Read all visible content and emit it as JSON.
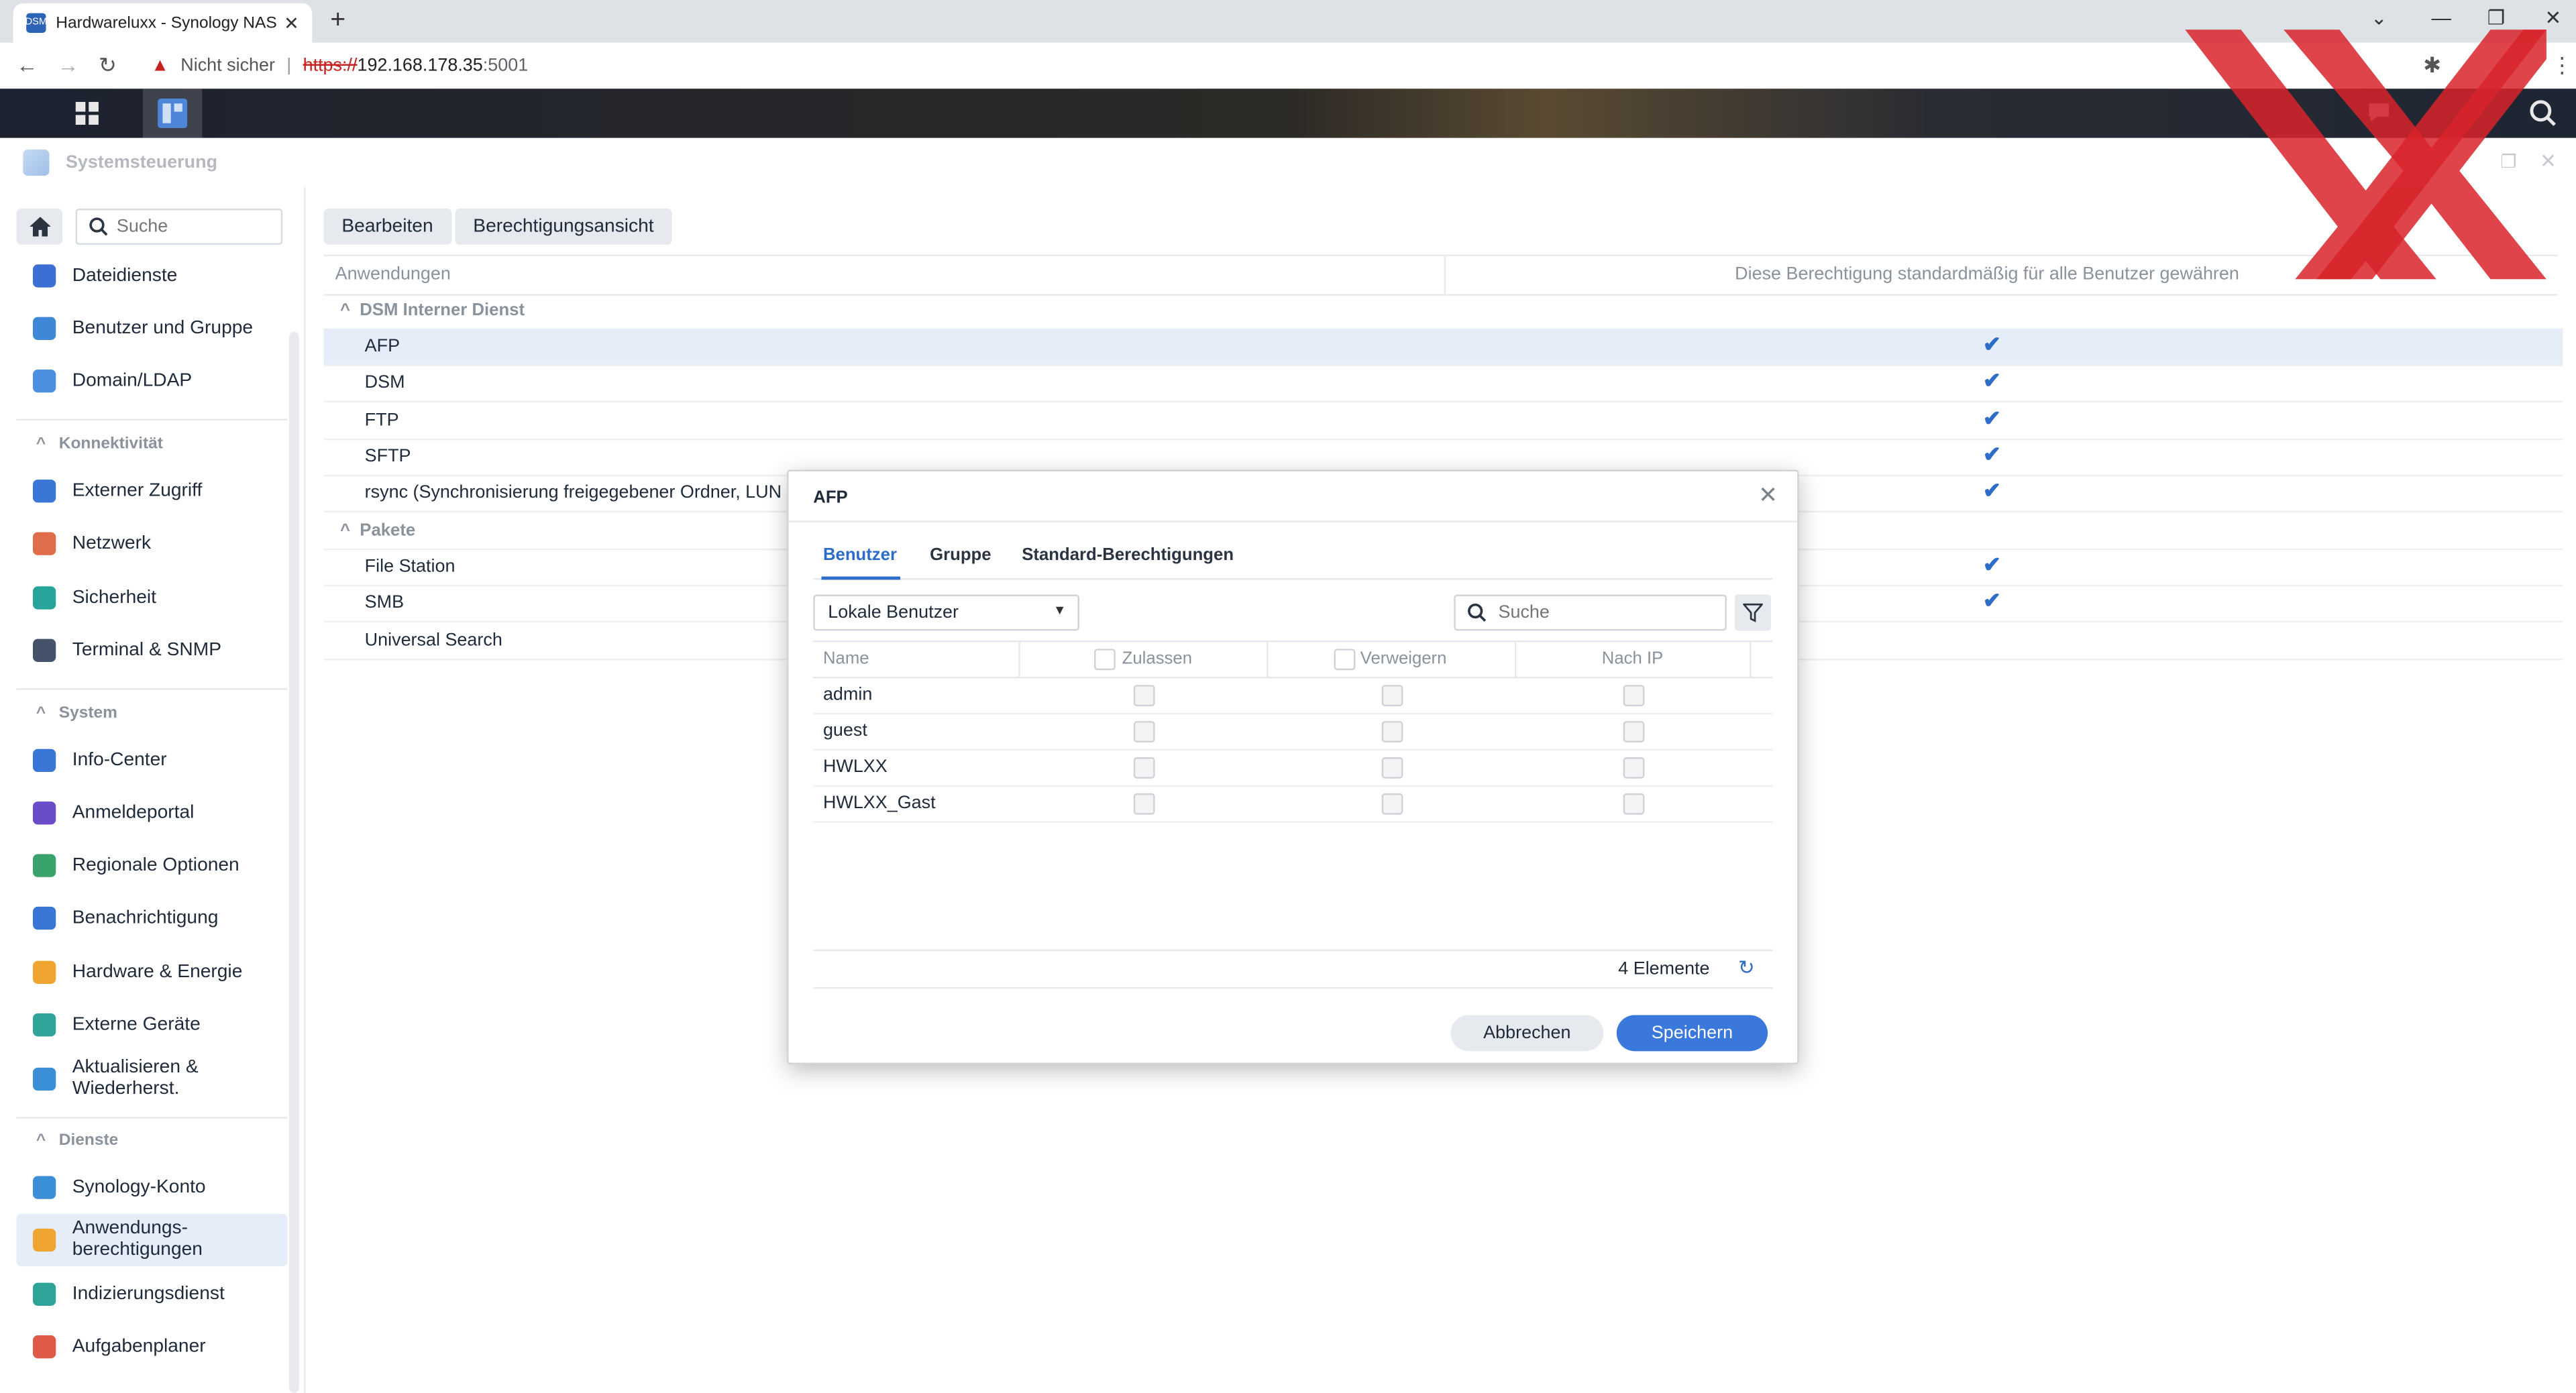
{
  "browser": {
    "tab_title": "Hardwareluxx - Synology NAS",
    "favicon_text": "DSM",
    "security_label": "Nicht sicher",
    "url_scheme": "https://",
    "url_host": "192.168.178.35",
    "url_port": ":5001"
  },
  "app": {
    "title": "Systemsteuerung"
  },
  "sidebar": {
    "search_placeholder": "Suche",
    "items_top": [
      {
        "label": "Dateidienste",
        "icon": "folder-share-icon",
        "color": "#3b6fd4"
      },
      {
        "label": "Benutzer und Gruppe",
        "icon": "users-icon",
        "color": "#3f88d8"
      },
      {
        "label": "Domain/LDAP",
        "icon": "domain-icon",
        "color": "#4a8fe0"
      }
    ],
    "section_connectivity": "Konnektivität",
    "items_connectivity": [
      {
        "label": "Externer Zugriff",
        "icon": "globe-icon",
        "color": "#3a76d6"
      },
      {
        "label": "Netzwerk",
        "icon": "house-network-icon",
        "color": "#e06d4a"
      },
      {
        "label": "Sicherheit",
        "icon": "shield-icon",
        "color": "#27a59a"
      },
      {
        "label": "Terminal & SNMP",
        "icon": "terminal-icon",
        "color": "#44536a"
      }
    ],
    "section_system": "System",
    "items_system": [
      {
        "label": "Info-Center",
        "icon": "info-icon",
        "color": "#3a76d6"
      },
      {
        "label": "Anmeldeportal",
        "icon": "portal-icon",
        "color": "#6a4bc8"
      },
      {
        "label": "Regionale Optionen",
        "icon": "region-icon",
        "color": "#3aa36b"
      },
      {
        "label": "Benachrichtigung",
        "icon": "notification-icon",
        "color": "#3a76d6"
      },
      {
        "label": "Hardware & Energie",
        "icon": "bulb-icon",
        "color": "#f0a530"
      },
      {
        "label": "Externe Geräte",
        "icon": "device-icon",
        "color": "#2fa59a"
      },
      {
        "label": "Aktualisieren & Wiederherst.",
        "icon": "update-icon",
        "color": "#3a8fd6"
      }
    ],
    "section_services": "Dienste",
    "items_services": [
      {
        "label": "Synology-Konto",
        "icon": "account-icon",
        "color": "#3a8fd6"
      },
      {
        "label": "Anwendungs-berechtigungen",
        "icon": "lock-icon",
        "color": "#f0a530",
        "active": true
      },
      {
        "label": "Indizierungsdienst",
        "icon": "index-icon",
        "color": "#2fa59a"
      },
      {
        "label": "Aufgabenplaner",
        "icon": "calendar-icon",
        "color": "#e05a4a"
      }
    ]
  },
  "main": {
    "edit_label": "Bearbeiten",
    "view_label": "Berechtigungsansicht",
    "col_apps": "Anwendungen",
    "col_default": "Diese Berechtigung standardmäßig für alle Benutzer gewähren",
    "group_internal": "DSM Interner Dienst",
    "internal_rows": [
      {
        "label": "AFP",
        "checked": true,
        "selected": true
      },
      {
        "label": "DSM",
        "checked": true
      },
      {
        "label": "FTP",
        "checked": true
      },
      {
        "label": "SFTP",
        "checked": true
      },
      {
        "label": "rsync (Synchronisierung freigegebener Ordner, LUN",
        "checked": true
      }
    ],
    "group_packages": "Pakete",
    "package_rows": [
      {
        "label": "File Station",
        "checked": true
      },
      {
        "label": "SMB",
        "checked": true
      },
      {
        "label": "Universal Search",
        "checked": false
      }
    ],
    "check_glyph": "✔"
  },
  "dialog": {
    "title": "AFP",
    "tabs": [
      "Benutzer",
      "Gruppe",
      "Standard-Berechtigungen"
    ],
    "active_tab": "Benutzer",
    "user_type": "Lokale Benutzer",
    "search_placeholder": "Suche",
    "col_name": "Name",
    "col_allow": "Zulassen",
    "col_deny": "Verweigern",
    "col_by_ip": "Nach IP",
    "users": [
      "admin",
      "guest",
      "HWLXX",
      "HWLXX_Gast"
    ],
    "count_label": "4 Elemente",
    "cancel_label": "Abbrechen",
    "save_label": "Speichern"
  },
  "colors": {
    "accent": "#2d6cc8",
    "primary_button": "#3a78dc",
    "watermark": "#d8232a"
  }
}
